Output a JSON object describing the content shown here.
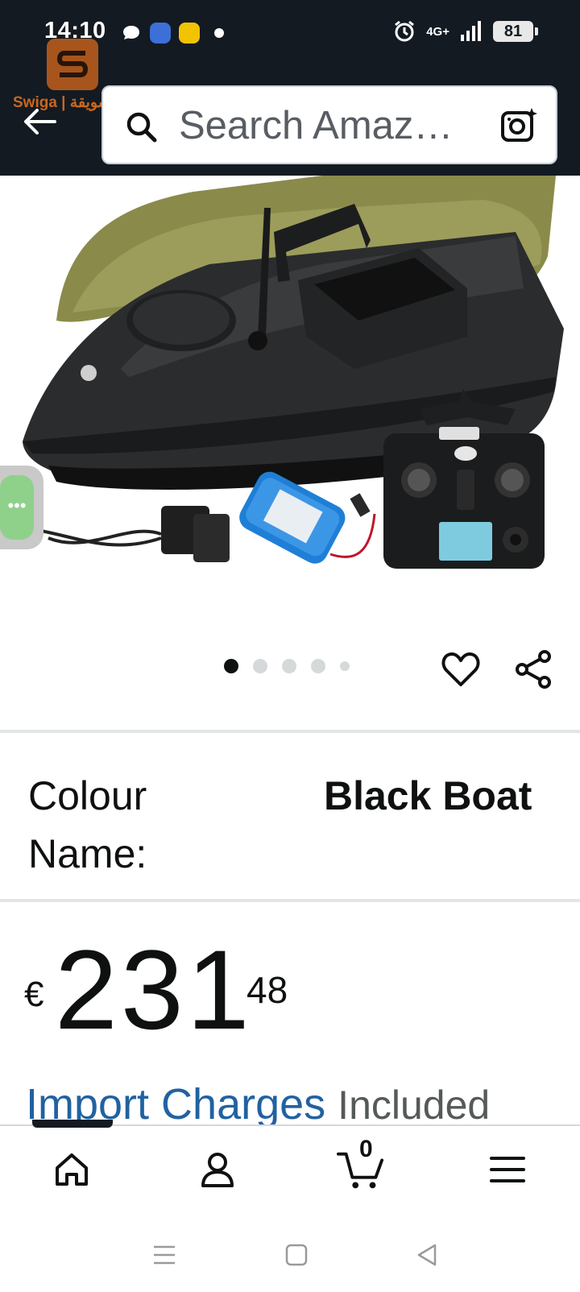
{
  "status_bar": {
    "time": "14:10",
    "network": "4G+",
    "battery": "81"
  },
  "watermark": {
    "text": "Swiga | سويقة"
  },
  "search": {
    "placeholder": "Search Amaz…"
  },
  "gallery": {
    "image_count": 5,
    "active_index": 0
  },
  "variation": {
    "label": "Colour Name:",
    "value": "Black Boat"
  },
  "price": {
    "currency": "€",
    "whole": "231",
    "fraction": "48"
  },
  "import_charges": {
    "link_text": "Import Charges",
    "suffix": "Included"
  },
  "bottom_nav": {
    "cart_count": "0",
    "items": [
      "home-icon",
      "account-icon",
      "cart-icon",
      "menu-icon"
    ]
  },
  "colors": {
    "header_bg": "#131a22",
    "link_blue": "#2162a1",
    "text": "#0f1111"
  }
}
